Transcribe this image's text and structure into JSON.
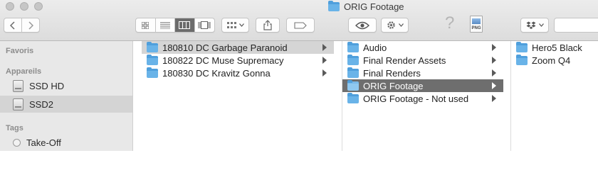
{
  "window": {
    "title": "ORIG Footage",
    "title_icon": "folder-icon"
  },
  "toolbar": {
    "back_icon": "chevron-left-icon",
    "forward_icon": "chevron-right-icon",
    "view_modes": [
      "icon-view",
      "list-view",
      "column-view",
      "gallery-view"
    ],
    "active_view": "column-view",
    "group_icon": "group-by-icon",
    "share_icon": "share-icon",
    "tag_icon": "tag-icon",
    "quicklook_icon": "eye-icon",
    "action_icon": "gear-icon",
    "unknown_icon": "question-mark-icon",
    "png_badge": "PNG",
    "dropbox_icon": "dropbox-icon"
  },
  "sidebar": {
    "favorites_heading": "Favoris",
    "devices_heading": "Appareils",
    "devices": [
      {
        "label": "SSD HD",
        "selected": false
      },
      {
        "label": "SSD2",
        "selected": true
      }
    ],
    "tags_heading": "Tags",
    "tags": [
      {
        "label": "Take-Off"
      }
    ]
  },
  "columns": [
    {
      "items": [
        {
          "label": "180810 DC Garbage Paranoid",
          "selected": "grey"
        },
        {
          "label": "180822 DC Muse Supremacy",
          "selected": ""
        },
        {
          "label": "180830 DC Kravitz Gonna",
          "selected": ""
        }
      ]
    },
    {
      "items": [
        {
          "label": "Audio",
          "selected": ""
        },
        {
          "label": "Final Render Assets",
          "selected": ""
        },
        {
          "label": "Final Renders",
          "selected": ""
        },
        {
          "label": "ORIG Footage",
          "selected": "dark"
        },
        {
          "label": "ORIG Footage - Not used",
          "selected": ""
        }
      ]
    },
    {
      "items": [
        {
          "label": "Hero5 Black",
          "selected": ""
        },
        {
          "label": "Zoom Q4",
          "selected": ""
        }
      ]
    }
  ]
}
